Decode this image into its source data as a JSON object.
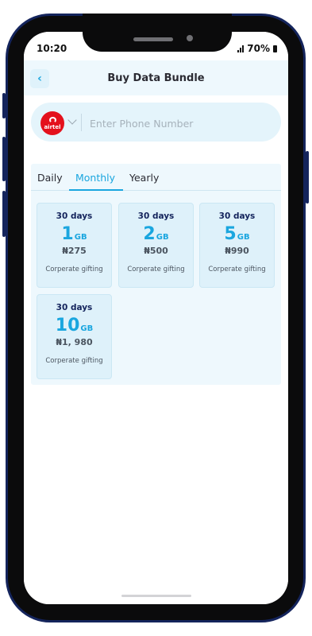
{
  "status_bar": {
    "time": "10:20",
    "battery": "70%",
    "signal_icon": "signal-icon",
    "battery_icon": "battery-icon"
  },
  "header": {
    "title": "Buy Data Bundle",
    "back_icon": "chevron-left-icon",
    "back_glyph": "‹"
  },
  "phone_input": {
    "network_logo_text": "airtel",
    "placeholder": "Enter Phone Number",
    "value": ""
  },
  "tabs": [
    {
      "label": "Daily",
      "active": false
    },
    {
      "label": "Monthly",
      "active": true
    },
    {
      "label": "Yearly",
      "active": false
    }
  ],
  "bundles": [
    {
      "days": "30 days",
      "size": "1",
      "unit": "GB",
      "price": "₦275",
      "tag": "Corperate gifting"
    },
    {
      "days": "30 days",
      "size": "2",
      "unit": "GB",
      "price": "₦500",
      "tag": "Corperate gifting"
    },
    {
      "days": "30 days",
      "size": "5",
      "unit": "GB",
      "price": "₦990",
      "tag": "Corperate gifting"
    },
    {
      "days": "30 days",
      "size": "10",
      "unit": "GB",
      "price": "₦1, 980",
      "tag": "Corperate gifting"
    }
  ],
  "colors": {
    "accent": "#1aa6df",
    "frame": "#14245c",
    "panel": "#eef8fd",
    "card": "#def1fa",
    "airtel_red": "#e4111c"
  }
}
